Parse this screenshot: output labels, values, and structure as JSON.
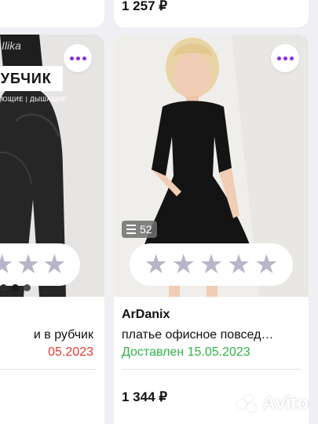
{
  "top_row": {
    "right_price": "1 257 ₽"
  },
  "left_card": {
    "brand_mark": "Ilika",
    "promo_label": "РУБЧИК",
    "promo_subtitle": "ВАЮЩИЕ | ДЫШАЩИЕ",
    "title": "и в рубчик",
    "delivery": "05.2023",
    "swatch_colors": [
      "#2a2a2a",
      "#1c1c1c",
      "#4a4f4e"
    ],
    "rating_stars": [
      "★",
      "★",
      "★"
    ]
  },
  "right_card": {
    "photo_count": "52",
    "seller": "ArDanix",
    "title": "платье офисное повсед…",
    "delivery": "Доставлен 15.05.2023",
    "price": "1 344 ₽",
    "rating_stars": [
      "★",
      "★",
      "★",
      "★",
      "★"
    ]
  },
  "watermark": {
    "text": "Avito"
  },
  "colors": {
    "accent": "#8a2be2",
    "delivered_green": "#2fb34a",
    "overdue_red": "#e53935",
    "star_empty": "#b8b5c9",
    "background": "#f0eff3"
  }
}
